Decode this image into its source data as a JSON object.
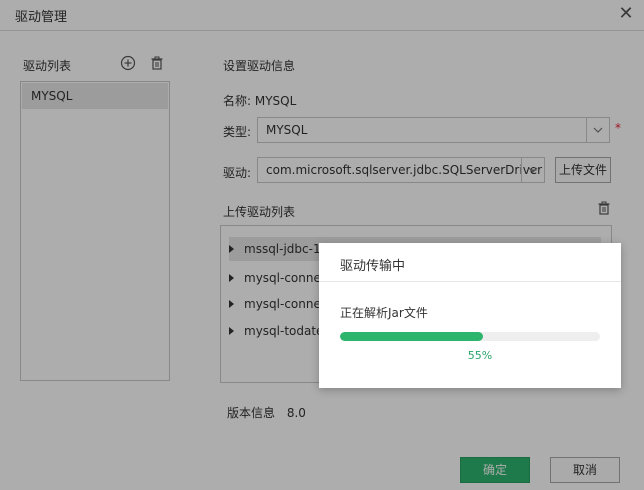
{
  "window": {
    "title": "驱动管理"
  },
  "left_panel": {
    "header": "驱动列表",
    "items": [
      {
        "label": "MYSQL",
        "selected": true
      }
    ]
  },
  "right_panel": {
    "section_title": "设置驱动信息",
    "name_label": "名称:",
    "name_value": "MYSQL",
    "type_label": "类型:",
    "type_value": "MYSQL",
    "driver_label": "驱动:",
    "driver_value": "com.microsoft.sqlserver.jdbc.SQLServerDriver",
    "upload_button": "上传文件",
    "upload_list_title": "上传驱动列表",
    "upload_list": [
      {
        "label": "mssql-jdbc-1"
      },
      {
        "label": "mysql-connec"
      },
      {
        "label": "mysql-connec"
      },
      {
        "label": "mysql-todate"
      }
    ],
    "version_label": "版本信息",
    "version_value": "8.0"
  },
  "progress_modal": {
    "title": "驱动传输中",
    "status": "正在解析Jar文件",
    "percent": 55,
    "percent_label": "55%"
  },
  "footer": {
    "ok": "确定",
    "cancel": "取消"
  },
  "colors": {
    "accent": "#2db46d",
    "required": "#e22233"
  }
}
